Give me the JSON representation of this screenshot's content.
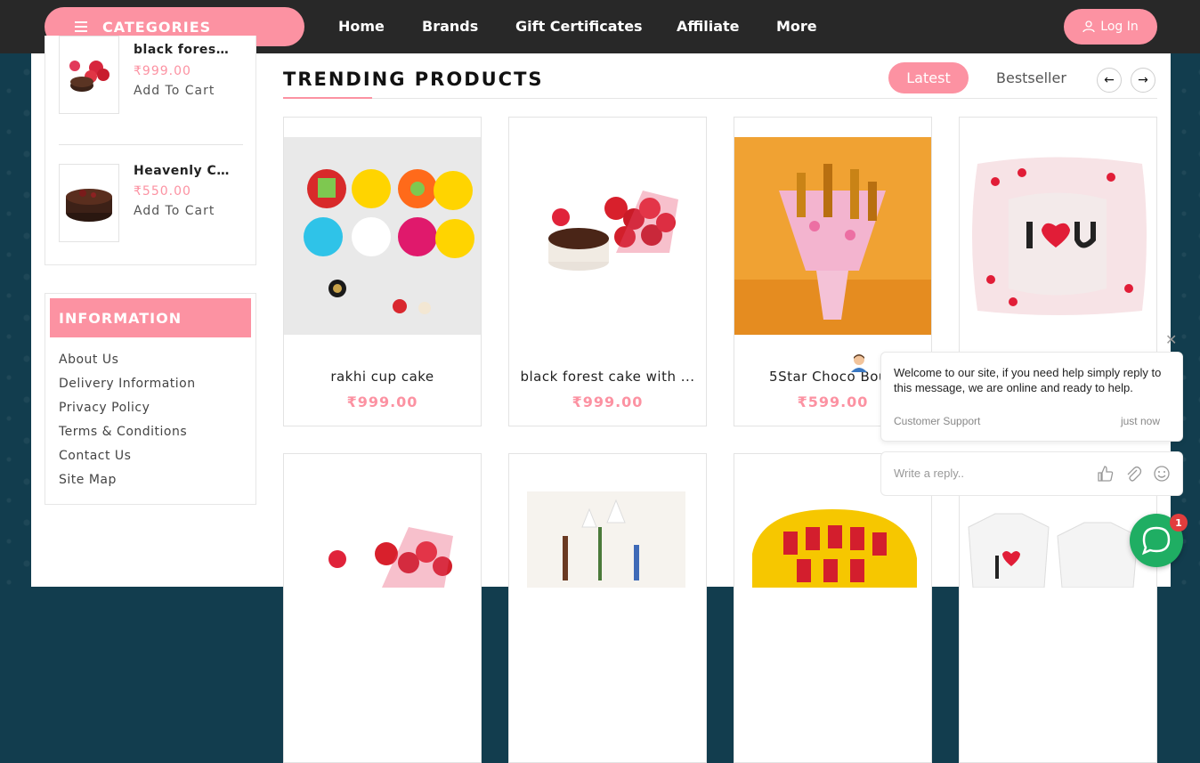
{
  "header": {
    "categories_label": "CATEGORIES",
    "nav": [
      "Home",
      "Brands",
      "Gift Certificates",
      "Affiliate",
      "More"
    ],
    "login_label": "Log In"
  },
  "sidebar": {
    "products": [
      {
        "name": "black forest ...",
        "price": "₹999.00",
        "cart": "Add To Cart"
      },
      {
        "name": "Heavenly Ch...",
        "price": "₹550.00",
        "cart": "Add To Cart"
      }
    ],
    "info_title": "INFORMATION",
    "info_links": [
      "About Us",
      "Delivery Information",
      "Privacy Policy",
      "Terms & Conditions",
      "Contact Us",
      "Site Map"
    ]
  },
  "main": {
    "title": "TRENDING PRODUCTS",
    "tabs": [
      "Latest",
      "Bestseller"
    ],
    "products": [
      {
        "name": "rakhi cup cake",
        "price": "₹999.00"
      },
      {
        "name": "black forest cake with ...",
        "price": "₹999.00"
      },
      {
        "name": "5Star Choco Bouq",
        "price": "₹599.00"
      },
      {
        "name": "",
        "price": ""
      }
    ]
  },
  "chat": {
    "message": "Welcome to our site, if you need help simply reply to this message, we are online and ready to help.",
    "from": "Customer Support",
    "time": "just now",
    "placeholder": "Write a reply..",
    "badge": "1"
  },
  "colors": {
    "accent": "#fc92a2",
    "topbar": "#282828",
    "chat_green": "#1fae63"
  }
}
